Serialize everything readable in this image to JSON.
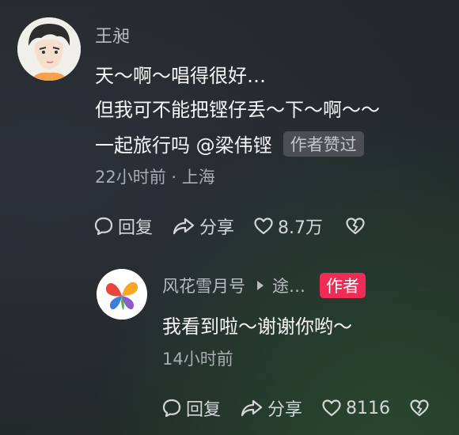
{
  "comment": {
    "username": "王昶",
    "lines": [
      "天～啊～唱得很好…",
      "但我可不能把铿仔丢～下～啊～～",
      "一起旅行吗 @梁伟铿"
    ],
    "liked_badge": "作者赞过",
    "time": "22小时前",
    "location": "上海",
    "actions": {
      "reply": "回复",
      "share": "分享",
      "likes": "8.7万"
    }
  },
  "reply": {
    "username": "风花雪月号",
    "reply_to": "途…",
    "author_badge": "作者",
    "text": "我看到啦～谢谢你哟～",
    "time": "14小时前",
    "actions": {
      "reply": "回复",
      "share": "分享",
      "likes": "8116"
    }
  },
  "colors": {
    "author_badge": "#ee2c55",
    "background": "#24292d"
  },
  "icons": [
    "comment-bubble-icon",
    "share-arrow-icon",
    "heart-icon",
    "dislike-broken-heart-icon",
    "play-triangle-icon"
  ]
}
